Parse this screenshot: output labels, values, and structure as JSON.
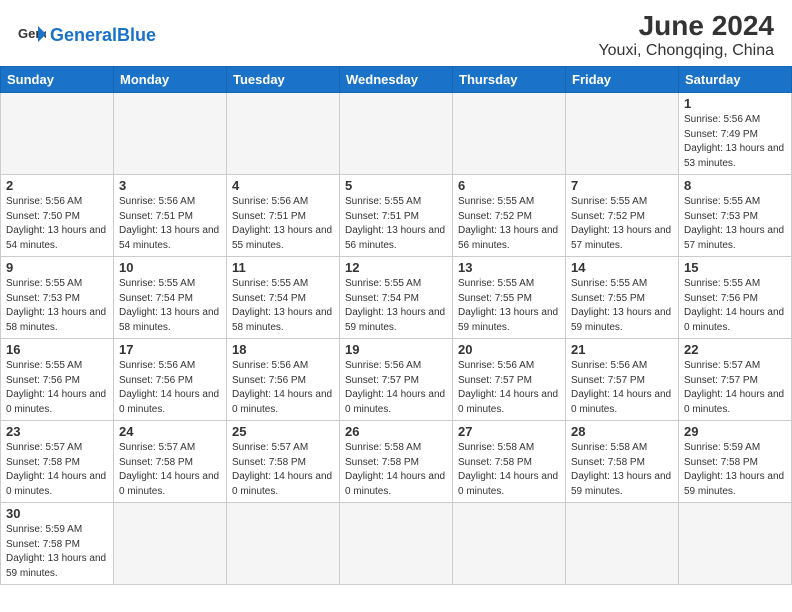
{
  "header": {
    "logo_general": "General",
    "logo_blue": "Blue",
    "title": "June 2024",
    "subtitle": "Youxi, Chongqing, China"
  },
  "weekdays": [
    "Sunday",
    "Monday",
    "Tuesday",
    "Wednesday",
    "Thursday",
    "Friday",
    "Saturday"
  ],
  "weeks": [
    [
      {
        "day": "",
        "empty": true
      },
      {
        "day": "",
        "empty": true
      },
      {
        "day": "",
        "empty": true
      },
      {
        "day": "",
        "empty": true
      },
      {
        "day": "",
        "empty": true
      },
      {
        "day": "",
        "empty": true
      },
      {
        "day": "1",
        "sunrise": "5:56 AM",
        "sunset": "7:49 PM",
        "daylight": "13 hours and 53 minutes."
      }
    ],
    [
      {
        "day": "2",
        "sunrise": "5:56 AM",
        "sunset": "7:50 PM",
        "daylight": "13 hours and 54 minutes."
      },
      {
        "day": "3",
        "sunrise": "5:56 AM",
        "sunset": "7:51 PM",
        "daylight": "13 hours and 54 minutes."
      },
      {
        "day": "4",
        "sunrise": "5:56 AM",
        "sunset": "7:51 PM",
        "daylight": "13 hours and 55 minutes."
      },
      {
        "day": "5",
        "sunrise": "5:55 AM",
        "sunset": "7:51 PM",
        "daylight": "13 hours and 56 minutes."
      },
      {
        "day": "6",
        "sunrise": "5:55 AM",
        "sunset": "7:52 PM",
        "daylight": "13 hours and 56 minutes."
      },
      {
        "day": "7",
        "sunrise": "5:55 AM",
        "sunset": "7:52 PM",
        "daylight": "13 hours and 57 minutes."
      },
      {
        "day": "8",
        "sunrise": "5:55 AM",
        "sunset": "7:53 PM",
        "daylight": "13 hours and 57 minutes."
      }
    ],
    [
      {
        "day": "9",
        "sunrise": "5:55 AM",
        "sunset": "7:53 PM",
        "daylight": "13 hours and 58 minutes."
      },
      {
        "day": "10",
        "sunrise": "5:55 AM",
        "sunset": "7:54 PM",
        "daylight": "13 hours and 58 minutes."
      },
      {
        "day": "11",
        "sunrise": "5:55 AM",
        "sunset": "7:54 PM",
        "daylight": "13 hours and 58 minutes."
      },
      {
        "day": "12",
        "sunrise": "5:55 AM",
        "sunset": "7:54 PM",
        "daylight": "13 hours and 59 minutes."
      },
      {
        "day": "13",
        "sunrise": "5:55 AM",
        "sunset": "7:55 PM",
        "daylight": "13 hours and 59 minutes."
      },
      {
        "day": "14",
        "sunrise": "5:55 AM",
        "sunset": "7:55 PM",
        "daylight": "13 hours and 59 minutes."
      },
      {
        "day": "15",
        "sunrise": "5:55 AM",
        "sunset": "7:56 PM",
        "daylight": "14 hours and 0 minutes."
      }
    ],
    [
      {
        "day": "16",
        "sunrise": "5:55 AM",
        "sunset": "7:56 PM",
        "daylight": "14 hours and 0 minutes."
      },
      {
        "day": "17",
        "sunrise": "5:56 AM",
        "sunset": "7:56 PM",
        "daylight": "14 hours and 0 minutes."
      },
      {
        "day": "18",
        "sunrise": "5:56 AM",
        "sunset": "7:56 PM",
        "daylight": "14 hours and 0 minutes."
      },
      {
        "day": "19",
        "sunrise": "5:56 AM",
        "sunset": "7:57 PM",
        "daylight": "14 hours and 0 minutes."
      },
      {
        "day": "20",
        "sunrise": "5:56 AM",
        "sunset": "7:57 PM",
        "daylight": "14 hours and 0 minutes."
      },
      {
        "day": "21",
        "sunrise": "5:56 AM",
        "sunset": "7:57 PM",
        "daylight": "14 hours and 0 minutes."
      },
      {
        "day": "22",
        "sunrise": "5:57 AM",
        "sunset": "7:57 PM",
        "daylight": "14 hours and 0 minutes."
      }
    ],
    [
      {
        "day": "23",
        "sunrise": "5:57 AM",
        "sunset": "7:58 PM",
        "daylight": "14 hours and 0 minutes."
      },
      {
        "day": "24",
        "sunrise": "5:57 AM",
        "sunset": "7:58 PM",
        "daylight": "14 hours and 0 minutes."
      },
      {
        "day": "25",
        "sunrise": "5:57 AM",
        "sunset": "7:58 PM",
        "daylight": "14 hours and 0 minutes."
      },
      {
        "day": "26",
        "sunrise": "5:58 AM",
        "sunset": "7:58 PM",
        "daylight": "14 hours and 0 minutes."
      },
      {
        "day": "27",
        "sunrise": "5:58 AM",
        "sunset": "7:58 PM",
        "daylight": "14 hours and 0 minutes."
      },
      {
        "day": "28",
        "sunrise": "5:58 AM",
        "sunset": "7:58 PM",
        "daylight": "13 hours and 59 minutes."
      },
      {
        "day": "29",
        "sunrise": "5:59 AM",
        "sunset": "7:58 PM",
        "daylight": "13 hours and 59 minutes."
      }
    ],
    [
      {
        "day": "30",
        "sunrise": "5:59 AM",
        "sunset": "7:58 PM",
        "daylight": "13 hours and 59 minutes."
      },
      {
        "day": "",
        "empty": true
      },
      {
        "day": "",
        "empty": true
      },
      {
        "day": "",
        "empty": true
      },
      {
        "day": "",
        "empty": true
      },
      {
        "day": "",
        "empty": true
      },
      {
        "day": "",
        "empty": true
      }
    ]
  ]
}
